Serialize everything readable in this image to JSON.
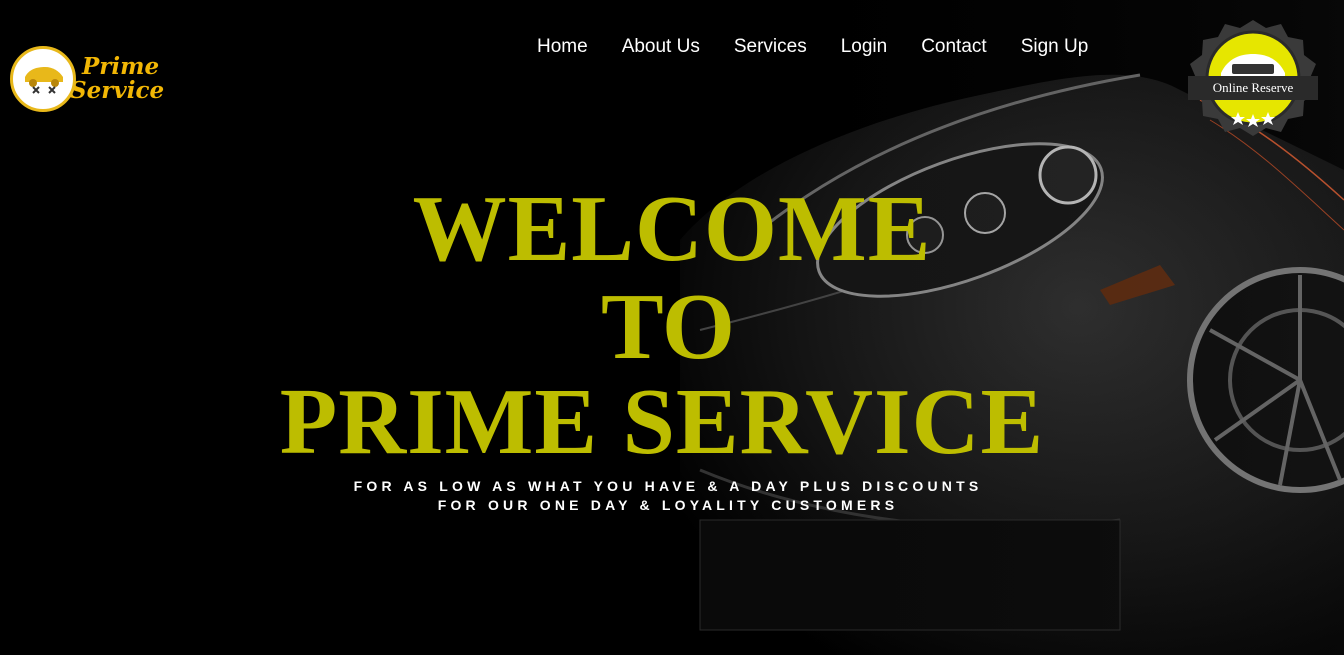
{
  "brand": {
    "line1": "Prime",
    "line2": "Service",
    "color": "#f2b705"
  },
  "nav": {
    "items": [
      "Home",
      "About Us",
      "Services",
      "Login",
      "Contact",
      "Sign Up"
    ]
  },
  "reserve_badge": {
    "label": "Online Reserve"
  },
  "hero": {
    "line1": "WELCOME",
    "line2": "TO",
    "line3": "PRIME SERVICE",
    "sub1": "FOR AS LOW AS WHAT YOU HAVE & A DAY PLUS DISCOUNTS",
    "sub2": "FOR OUR ONE DAY & LOYALITY CUSTOMERS",
    "accent": "#bdbd00"
  }
}
